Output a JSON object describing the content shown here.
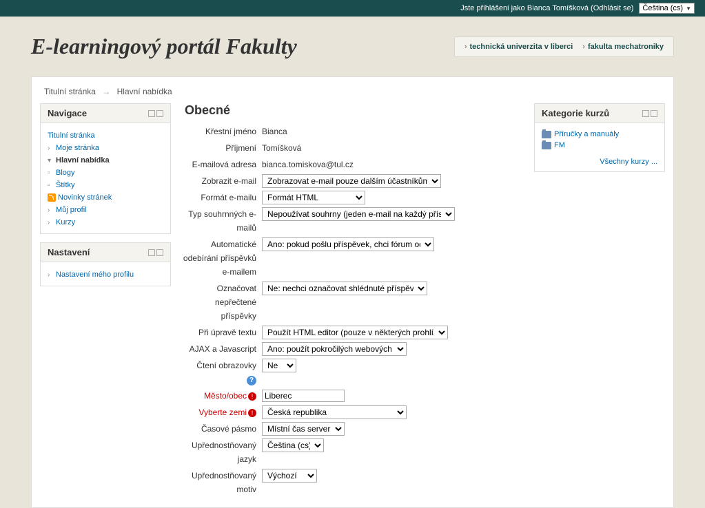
{
  "topbar": {
    "login_prefix": "Jste přihlášeni jako",
    "user_name": "Bianca Tomíšková",
    "logout": "Odhlásit se",
    "language": "Čeština (cs)"
  },
  "header": {
    "title": "E-learningový portál Fakulty",
    "link1": "technická univerzita v liberci",
    "link2": "fakulta mechatroniky"
  },
  "breadcrumb": {
    "home": "Titulní stránka",
    "current": "Hlavní nabídka"
  },
  "nav": {
    "title": "Navigace",
    "items": {
      "home": "Titulní stránka",
      "mypage": "Moje stránka",
      "mainmenu": "Hlavní nabídka",
      "blogs": "Blogy",
      "tags": "Štítky",
      "news": "Novinky stránek",
      "profile": "Můj profil",
      "courses": "Kurzy"
    }
  },
  "settings": {
    "title": "Nastavení",
    "profile_settings": "Nastavení mého profilu"
  },
  "form": {
    "section": "Obecné",
    "firstname": {
      "label": "Křestní jméno",
      "value": "Bianca"
    },
    "surname": {
      "label": "Příjmení",
      "value": "Tomíšková"
    },
    "email": {
      "label": "E-mailová adresa",
      "value": "bianca.tomiskova@tul.cz"
    },
    "email_display": {
      "label": "Zobrazit e-mail",
      "value": "Zobrazovat e-mail pouze dalším účastníkům kurzu"
    },
    "email_format": {
      "label": "Formát e-mailu",
      "value": "Formát HTML"
    },
    "digest": {
      "label": "Typ souhrnných e-mailů",
      "value": "Nepoužívat souhrny (jeden e-mail na každý příspěvek)"
    },
    "autosub": {
      "label": "Automatické odebírání příspěvků e-mailem",
      "value": "Ano: pokud pošlu příspěvek, chci fórum odebírat"
    },
    "track": {
      "label": "Označovat nepřečtené příspěvky",
      "value": "Ne: nechci označovat shlédnuté příspěvky"
    },
    "editor": {
      "label": "Při úpravě textu",
      "value": "Použít HTML editor (pouze v některých prohlížečích)"
    },
    "ajax": {
      "label": "AJAX a Javascript",
      "value": "Ano: použít pokročilých webových funkcí"
    },
    "screenreader": {
      "label": "Čtení obrazovky",
      "value": "Ne"
    },
    "city": {
      "label": "Město/obec",
      "value": "Liberec"
    },
    "country": {
      "label": "Vyberte zemi",
      "value": "Česká republika"
    },
    "timezone": {
      "label": "Časové pásmo",
      "value": "Místní čas serveru"
    },
    "lang": {
      "label": "Upřednostňovaný jazyk",
      "value": "Čeština (cs)"
    },
    "theme": {
      "label": "Upřednostňovaný motiv",
      "value": "Výchozí"
    }
  },
  "categories": {
    "title": "Kategorie kurzů",
    "item1": "Příručky a manuály",
    "item2": "FM",
    "all": "Všechny kurzy ..."
  }
}
